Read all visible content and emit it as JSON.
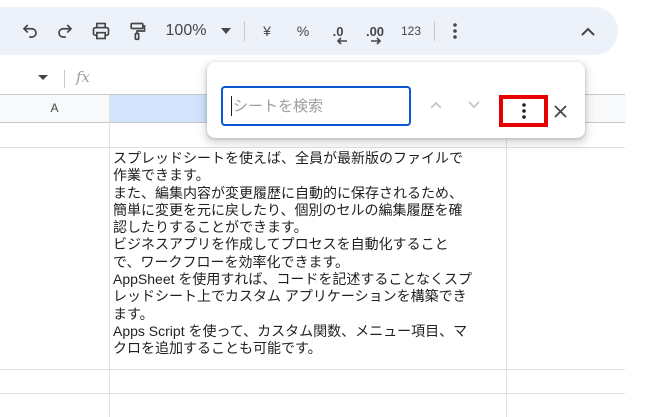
{
  "toolbar": {
    "zoom": "100%",
    "currency": "¥",
    "percent": "%",
    "decrease_decimal": ".0",
    "increase_decimal": ".00",
    "number_format": "123",
    "icons": [
      "undo-icon",
      "redo-icon",
      "print-icon",
      "paint-format-icon",
      "chevron-down-icon",
      "more-vert-icon",
      "chevron-up-icon"
    ]
  },
  "formula_bar": {
    "fx_label": "fx"
  },
  "grid": {
    "column_a_header": "A",
    "cell_lines": [
      "スプレッドシートを使えば、全員が最新版のファイルで",
      "作業できます。",
      "また、編集内容が変更履歴に自動的に保存されるため、",
      "簡単に変更を元に戻したり、個別のセルの編集履歴を確",
      "認したりすることができます。",
      "ビジネスアプリを作成してプロセスを自動化すること",
      "で、ワークフローを効率化できます。",
      "AppSheet を使用すれば、コードを記述することなくスプ",
      "レッドシート上でカスタム アプリケーションを構築でき",
      "ます。",
      "Apps Script を使って、カスタム関数、メニュー項目、マ",
      "クロを追加することも可能です。"
    ]
  },
  "find_dialog": {
    "search_placeholder": "シートを検索",
    "search_value": "",
    "highlight_color": "#e60000",
    "input_border_color": "#0b57d0"
  },
  "colors": {
    "toolbar_bg": "#edf2fa",
    "selected_column_header": "#d3e3fd"
  }
}
